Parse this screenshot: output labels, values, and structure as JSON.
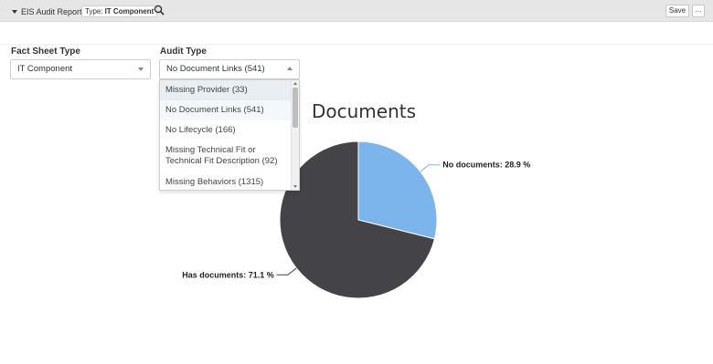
{
  "toolbar": {
    "reports_menu_label": "EIS Audit Reports",
    "type_chip_prefix": "Type:",
    "type_chip_value": "IT Component",
    "save_label": "Save",
    "more_label": "..."
  },
  "filters": {
    "fact_sheet_type": {
      "label": "Fact Sheet Type",
      "value": "IT Component"
    },
    "audit_type": {
      "label": "Audit Type",
      "value": "No Document Links (541)",
      "open": true,
      "options": [
        "Missing Provider (33)",
        "No Document Links (541)",
        "No Lifecycle (166)",
        "Missing Technical Fit or Technical Fit Description (92)",
        "Missing Behaviors (1315)"
      ],
      "hovered_index": 0,
      "selected_index": 1
    }
  },
  "chart_data": {
    "type": "pie",
    "title": "Documents",
    "slices": [
      {
        "label": "No documents",
        "value": 28.9,
        "color": "#7cb5ec",
        "display": "No documents: 28.9 %"
      },
      {
        "label": "Has documents",
        "value": 71.1,
        "color": "#434348",
        "display": "Has documents: 71.1 %"
      }
    ]
  }
}
